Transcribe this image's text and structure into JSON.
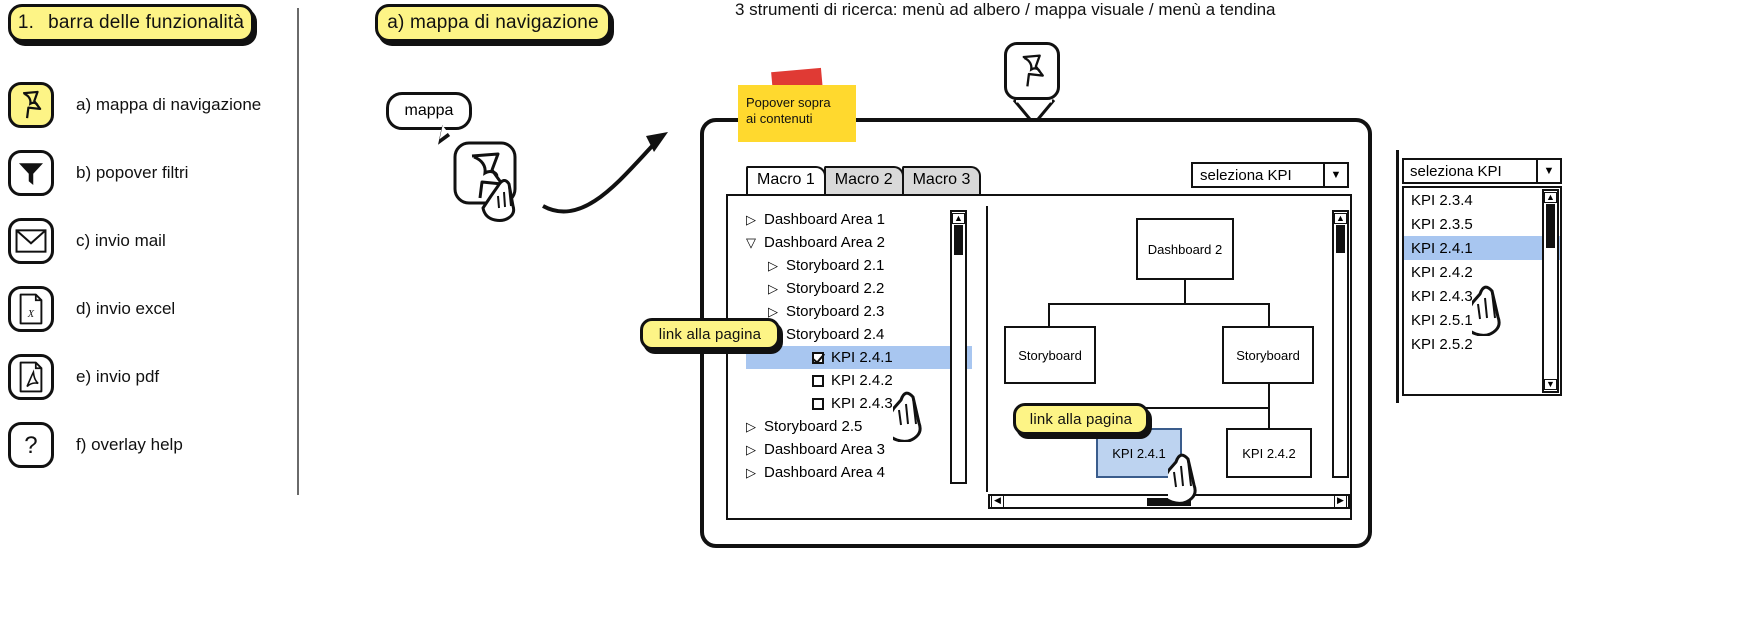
{
  "left_panel": {
    "title_number": "1.",
    "title": "barra delle funzionalità",
    "features": [
      {
        "key": "a",
        "label": "a) mappa di navigazione",
        "icon": "pin-icon",
        "highlighted": true
      },
      {
        "key": "b",
        "label": "b) popover filtri",
        "icon": "funnel-icon",
        "highlighted": false
      },
      {
        "key": "c",
        "label": "c) invio mail",
        "icon": "envelope-icon",
        "highlighted": false
      },
      {
        "key": "d",
        "label": "d) invio excel",
        "icon": "excel-file-icon",
        "highlighted": false
      },
      {
        "key": "e",
        "label": "e) invio pdf",
        "icon": "pdf-file-icon",
        "highlighted": false
      },
      {
        "key": "f",
        "label": "f) overlay help",
        "icon": "question-mark-icon",
        "highlighted": false
      }
    ]
  },
  "middle": {
    "section_chip": "a) mappa di navigazione",
    "tooltip": "mappa"
  },
  "caption": "3 strumenti di ricerca: menù ad albero / mappa visuale / menù a tendina",
  "sticky_note": {
    "line1": "Popover sopra",
    "line2": "ai contenuti"
  },
  "window": {
    "tabs": [
      {
        "label": "Macro 1",
        "active": true
      },
      {
        "label": "Macro 2",
        "active": false
      },
      {
        "label": "Macro 3",
        "active": false
      }
    ],
    "kpi_select_value": "seleziona KPI",
    "tree": [
      {
        "label": "Dashboard Area 1",
        "level": 1,
        "caret": "collapsed",
        "checkbox": null,
        "selected": false
      },
      {
        "label": "Dashboard Area 2",
        "level": 1,
        "caret": "expanded",
        "checkbox": null,
        "selected": false
      },
      {
        "label": "Storyboard 2.1",
        "level": 2,
        "caret": "collapsed",
        "checkbox": null,
        "selected": false
      },
      {
        "label": "Storyboard 2.2",
        "level": 2,
        "caret": "collapsed",
        "checkbox": null,
        "selected": false
      },
      {
        "label": "Storyboard 2.3",
        "level": 2,
        "caret": "collapsed",
        "checkbox": null,
        "selected": false
      },
      {
        "label": "Storyboard 2.4",
        "level": 2,
        "caret": "expanded",
        "checkbox": null,
        "selected": false
      },
      {
        "label": "KPI 2.4.1",
        "level": 3,
        "caret": "none",
        "checkbox": "checked",
        "selected": true
      },
      {
        "label": "KPI 2.4.2",
        "level": 3,
        "caret": "none",
        "checkbox": "unchecked",
        "selected": false
      },
      {
        "label": "KPI 2.4.3",
        "level": 3,
        "caret": "none",
        "checkbox": "unchecked",
        "selected": false
      },
      {
        "label": "Storyboard 2.5",
        "level": 1,
        "caret": "collapsed",
        "checkbox": null,
        "selected": false
      },
      {
        "label": "Dashboard Area 3",
        "level": 1,
        "caret": "collapsed",
        "checkbox": null,
        "selected": false
      },
      {
        "label": "Dashboard Area 4",
        "level": 1,
        "caret": "collapsed",
        "checkbox": null,
        "selected": false
      }
    ],
    "map": {
      "root": "Dashboard 2",
      "children": [
        "Storyboard",
        "Storyboard"
      ],
      "leaves": [
        "KPI 2.4.1",
        "KPI 2.4.2"
      ],
      "selected_leaf": "KPI 2.4.1"
    }
  },
  "annotations": {
    "link_tree": "link alla pagina",
    "link_map": "link alla pagina"
  },
  "dropdown_panel": {
    "header_value": "seleziona KPI",
    "options": [
      {
        "label": "KPI 2.3.4",
        "selected": false
      },
      {
        "label": "KPI 2.3.5",
        "selected": false
      },
      {
        "label": "KPI 2.4.1",
        "selected": true
      },
      {
        "label": "KPI 2.4.2",
        "selected": false
      },
      {
        "label": "KPI 2.4.3",
        "selected": false
      },
      {
        "label": "KPI 2.5.1",
        "selected": false
      },
      {
        "label": "KPI 2.5.2",
        "selected": false
      }
    ]
  },
  "colors": {
    "chip_yellow": "#fdf486",
    "sticky_yellow": "#ffd92e",
    "tape_red": "#e03a34",
    "selection_blue": "#a8c6f0",
    "map_selected_blue": "#bdd3f0",
    "tab_inactive": "#d9d9d9",
    "ink": "#111111"
  }
}
